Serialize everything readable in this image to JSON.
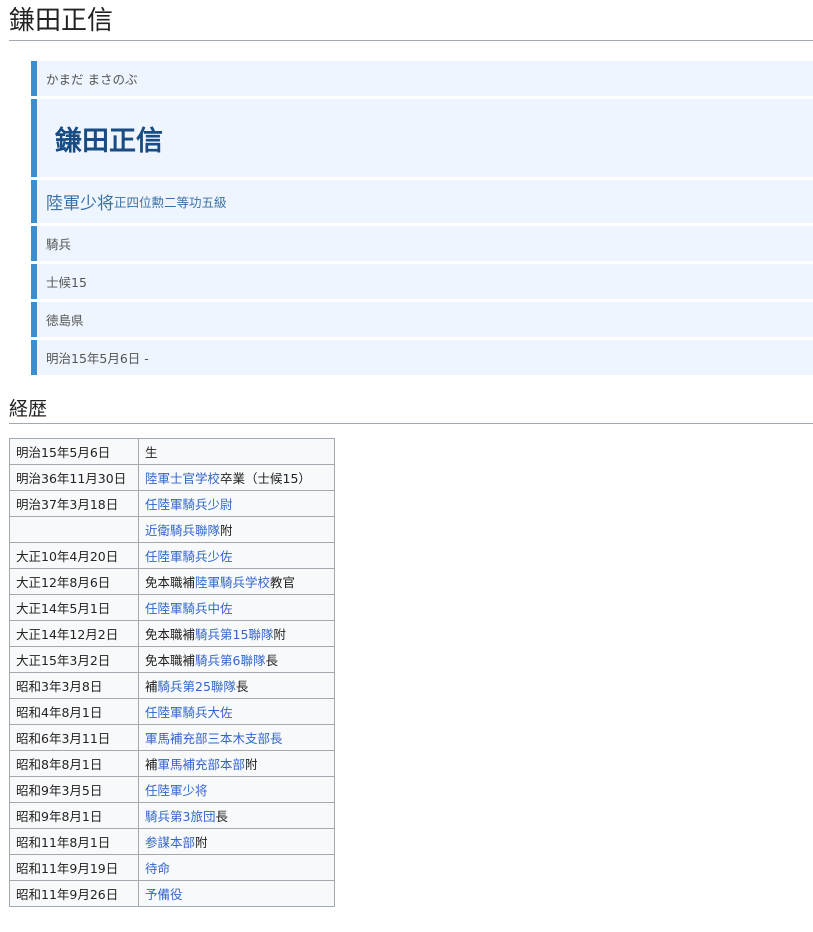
{
  "page_title": "鎌田正信",
  "infobox": {
    "kana": "かまだ まさのぶ",
    "name": "鎌田正信",
    "rank_main": "陸軍少将",
    "rank_sub": "正四位勲二等功五級",
    "branch": "騎兵",
    "class": "士候15",
    "origin": "徳島県",
    "lifespan": "明治15年5月6日 -"
  },
  "career": {
    "heading": "経歴",
    "rows": [
      {
        "date": "明治15年5月6日",
        "event": [
          "生"
        ]
      },
      {
        "date": "明治36年11月30日",
        "event": [
          "陸軍士官学校",
          "卒業（士候15）"
        ]
      },
      {
        "date": "明治37年3月18日",
        "event": [
          "任陸軍騎兵少尉"
        ]
      },
      {
        "date": "",
        "event": [
          "近衛騎兵聯隊",
          "附"
        ]
      },
      {
        "date": "大正10年4月20日",
        "event": [
          "任陸軍騎兵少佐"
        ]
      },
      {
        "date": "大正12年8月6日",
        "event": [
          "免本職補",
          "陸軍騎兵学校",
          "教官"
        ]
      },
      {
        "date": "大正14年5月1日",
        "event": [
          "任陸軍騎兵中佐"
        ]
      },
      {
        "date": "大正14年12月2日",
        "event": [
          "免本職補",
          "騎兵第15聯隊",
          "附"
        ]
      },
      {
        "date": "大正15年3月2日",
        "event": [
          "免本職補",
          "騎兵第6聯隊",
          "長"
        ]
      },
      {
        "date": "昭和3年3月8日",
        "event": [
          "補",
          "騎兵第25聯隊",
          "長"
        ]
      },
      {
        "date": "昭和4年8月1日",
        "event": [
          "任陸軍騎兵大佐"
        ]
      },
      {
        "date": "昭和6年3月11日",
        "event": [
          "軍馬補充部三本木支部長"
        ]
      },
      {
        "date": "昭和8年8月1日",
        "event": [
          "補",
          "軍馬補充部本部",
          "附"
        ]
      },
      {
        "date": "昭和9年3月5日",
        "event": [
          "任陸軍少将"
        ]
      },
      {
        "date": "昭和9年8月1日",
        "event": [
          "騎兵第3旅団",
          "長"
        ]
      },
      {
        "date": "昭和11年8月1日",
        "event": [
          "参謀本部",
          "附"
        ]
      },
      {
        "date": "昭和11年9月19日",
        "event": [
          "待命"
        ]
      },
      {
        "date": "昭和11年9月26日",
        "event": [
          "予備役"
        ]
      }
    ]
  },
  "colors": {
    "accent": "#3b8fd0",
    "infobox_bg": "#eef5fe",
    "name": "#184c83",
    "link": "#3366cc"
  }
}
